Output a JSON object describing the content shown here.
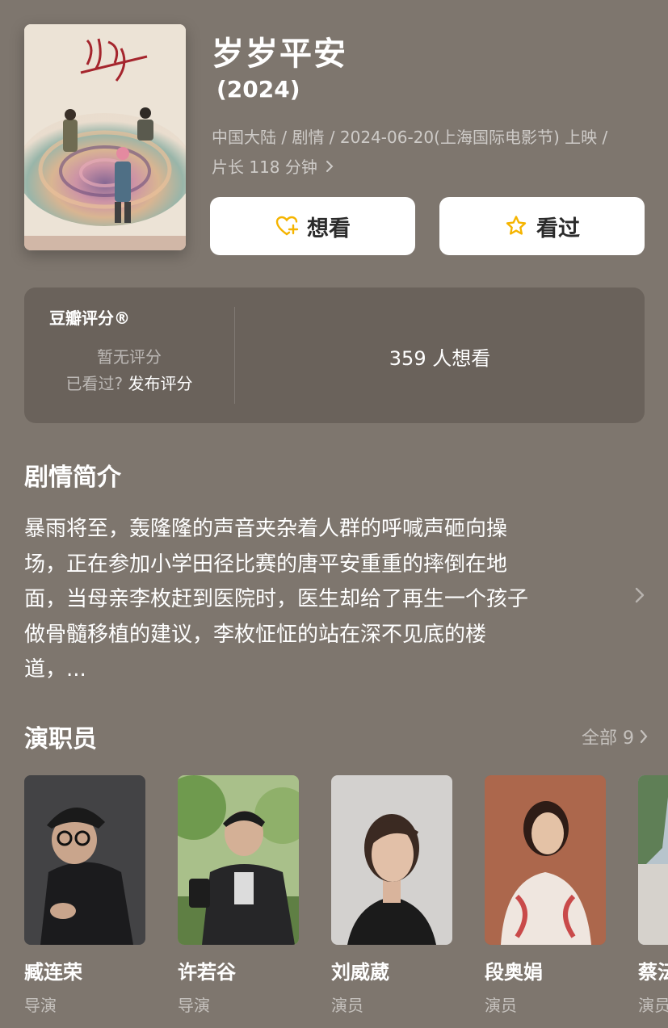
{
  "movie": {
    "title": "岁岁平安",
    "year": "(2024)",
    "meta_line1": "中国大陆 / 剧情 / 2024-06-20(上海国际电影节) 上映 /",
    "meta_line2": "片长 118 分钟"
  },
  "actions": {
    "want_label": "想看",
    "seen_label": "看过"
  },
  "rating": {
    "brand": "豆瓣评分®",
    "no_score": "暂无评分",
    "seen_question": "已看过?",
    "rate_action": "发布评分",
    "want_count": "359 人想看"
  },
  "synopsis": {
    "heading": "剧情简介",
    "lines": [
      "暴雨将至，轰隆隆的声音夹杂着人群的呼喊声砸向操",
      "场，正在参加小学田径比赛的唐平安重重的摔倒在地",
      "面，当母亲李枚赶到医院时，医生却给了再生一个孩子",
      "做骨髓移植的建议，李枚怔怔的站在深不见底的楼",
      "道，..."
    ]
  },
  "cast": {
    "heading": "演职员",
    "all_label": "全部 9",
    "members": [
      {
        "name": "臧连荣",
        "role": "导演"
      },
      {
        "name": "许若谷",
        "role": "导演"
      },
      {
        "name": "刘威葳",
        "role": "演员"
      },
      {
        "name": "段奥娟",
        "role": "演员"
      },
      {
        "name": "蔡沄",
        "role": "演员"
      }
    ]
  },
  "colors": {
    "background": "#7e766e",
    "card": "#6a625b",
    "accent_yellow": "#f5b400"
  }
}
